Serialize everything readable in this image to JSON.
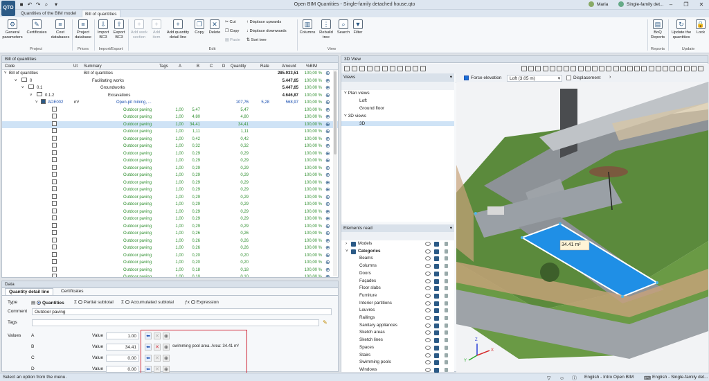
{
  "window": {
    "title": "Open BIM Quantities - Single-family detached house.qto",
    "user": "Maria",
    "project": "Single-family det...",
    "logo": "QTO"
  },
  "ribbon_tabs": [
    "Quantities of the BIM model",
    "Bill of quantities"
  ],
  "ribbon": {
    "groups": [
      "Project",
      "Prices",
      "Import/Export",
      "Edit",
      "View",
      "Reports",
      "Update"
    ],
    "general_parameters": "General parameters",
    "certificates": "Certificates",
    "cost_databases": "Cost databases",
    "project_database": "Project database",
    "import_bc3": "Import BC3",
    "export_bc3": "Export BC3",
    "add_work_section": "Add work section",
    "add_item": "Add item",
    "add_quantity_detail_line": "Add quantity detail line",
    "copy": "Copy",
    "delete": "Delete",
    "cut": "Cut",
    "copy_small": "Copy",
    "paste": "Paste",
    "displace_upwards": "Displace upwards",
    "displace_downwards": "Displace downwards",
    "sort_tree": "Sort tree",
    "columns": "Columns",
    "rebuild_tree": "Rebuild tree",
    "search": "Search",
    "filter": "Filter",
    "boq_reports": "BoQ Reports",
    "update_quantities": "Update the quantities",
    "lock": "Lock"
  },
  "boq": {
    "panel_title": "Bill of quantities",
    "columns": [
      "Code",
      "Ut",
      "Summary",
      "Tags",
      "A",
      "B",
      "C",
      "D",
      "Quantity",
      "Rate",
      "Amount",
      "%BIM"
    ],
    "rows": [
      {
        "code": "Bill of quantities",
        "ut": "",
        "summary": "Bill of quantities",
        "a": "",
        "b": "",
        "quantity": "",
        "rate": "",
        "amount": "285.933,51",
        "bim": "100,00 %",
        "kind": "root"
      },
      {
        "code": "0",
        "ut": "",
        "summary": "Facilitating works",
        "a": "",
        "b": "",
        "quantity": "",
        "rate": "",
        "amount": "5.447,65",
        "bim": "100,00 %",
        "kind": "chapter"
      },
      {
        "code": "0.1",
        "ut": "",
        "summary": "Groundworks",
        "a": "",
        "b": "",
        "quantity": "",
        "rate": "",
        "amount": "5.447,65",
        "bim": "100,00 %",
        "kind": "chapter"
      },
      {
        "code": "0.1.2",
        "ut": "",
        "summary": "Excavations",
        "a": "",
        "b": "",
        "quantity": "",
        "rate": "",
        "amount": "4.646,87",
        "bim": "100,00 %",
        "kind": "chapter"
      },
      {
        "code": "ADE002",
        "ut": "m³",
        "summary": "Open-pit mining, ...",
        "a": "",
        "b": "",
        "quantity": "107,76",
        "rate": "5,28",
        "amount": "568,97",
        "bim": "100,00 %",
        "kind": "item"
      },
      {
        "code": "",
        "ut": "",
        "summary": "Outdoor paving",
        "a": "1,00",
        "b": "5,47",
        "quantity": "5,47",
        "rate": "",
        "amount": "",
        "bim": "100,00 %",
        "kind": "line"
      },
      {
        "code": "",
        "ut": "",
        "summary": "Outdoor paving",
        "a": "1,00",
        "b": "4,80",
        "quantity": "4,80",
        "rate": "",
        "amount": "",
        "bim": "100,00 %",
        "kind": "line"
      },
      {
        "code": "",
        "ut": "",
        "summary": "Outdoor paving",
        "a": "1,00",
        "b": "34,41",
        "quantity": "34,41",
        "rate": "",
        "amount": "",
        "bim": "100,00 %",
        "kind": "line",
        "selected": true
      },
      {
        "code": "",
        "ut": "",
        "summary": "Outdoor paving",
        "a": "1,00",
        "b": "1,11",
        "quantity": "1,11",
        "rate": "",
        "amount": "",
        "bim": "100,00 %",
        "kind": "line"
      },
      {
        "code": "",
        "ut": "",
        "summary": "Outdoor paving",
        "a": "1,00",
        "b": "0,42",
        "quantity": "0,42",
        "rate": "",
        "amount": "",
        "bim": "100,00 %",
        "kind": "line"
      },
      {
        "code": "",
        "ut": "",
        "summary": "Outdoor paving",
        "a": "1,00",
        "b": "0,32",
        "quantity": "0,32",
        "rate": "",
        "amount": "",
        "bim": "100,00 %",
        "kind": "line"
      },
      {
        "code": "",
        "ut": "",
        "summary": "Outdoor paving",
        "a": "1,00",
        "b": "0,29",
        "quantity": "0,29",
        "rate": "",
        "amount": "",
        "bim": "100,00 %",
        "kind": "line"
      },
      {
        "code": "",
        "ut": "",
        "summary": "Outdoor paving",
        "a": "1,00",
        "b": "0,29",
        "quantity": "0,29",
        "rate": "",
        "amount": "",
        "bim": "100,00 %",
        "kind": "line"
      },
      {
        "code": "",
        "ut": "",
        "summary": "Outdoor paving",
        "a": "1,00",
        "b": "0,29",
        "quantity": "0,29",
        "rate": "",
        "amount": "",
        "bim": "100,00 %",
        "kind": "line"
      },
      {
        "code": "",
        "ut": "",
        "summary": "Outdoor paving",
        "a": "1,00",
        "b": "0,29",
        "quantity": "0,29",
        "rate": "",
        "amount": "",
        "bim": "100,00 %",
        "kind": "line"
      },
      {
        "code": "",
        "ut": "",
        "summary": "Outdoor paving",
        "a": "1,00",
        "b": "0,29",
        "quantity": "0,29",
        "rate": "",
        "amount": "",
        "bim": "100,00 %",
        "kind": "line"
      },
      {
        "code": "",
        "ut": "",
        "summary": "Outdoor paving",
        "a": "1,00",
        "b": "0,29",
        "quantity": "0,29",
        "rate": "",
        "amount": "",
        "bim": "100,00 %",
        "kind": "line"
      },
      {
        "code": "",
        "ut": "",
        "summary": "Outdoor paving",
        "a": "1,00",
        "b": "0,29",
        "quantity": "0,29",
        "rate": "",
        "amount": "",
        "bim": "100,00 %",
        "kind": "line"
      },
      {
        "code": "",
        "ut": "",
        "summary": "Outdoor paving",
        "a": "1,00",
        "b": "0,29",
        "quantity": "0,29",
        "rate": "",
        "amount": "",
        "bim": "100,00 %",
        "kind": "line"
      },
      {
        "code": "",
        "ut": "",
        "summary": "Outdoor paving",
        "a": "1,00",
        "b": "0,29",
        "quantity": "0,29",
        "rate": "",
        "amount": "",
        "bim": "100,00 %",
        "kind": "line"
      },
      {
        "code": "",
        "ut": "",
        "summary": "Outdoor paving",
        "a": "1,00",
        "b": "0,29",
        "quantity": "0,29",
        "rate": "",
        "amount": "",
        "bim": "100,00 %",
        "kind": "line"
      },
      {
        "code": "",
        "ut": "",
        "summary": "Outdoor paving",
        "a": "1,00",
        "b": "0,29",
        "quantity": "0,29",
        "rate": "",
        "amount": "",
        "bim": "100,00 %",
        "kind": "line"
      },
      {
        "code": "",
        "ut": "",
        "summary": "Outdoor paving",
        "a": "1,00",
        "b": "0,26",
        "quantity": "0,26",
        "rate": "",
        "amount": "",
        "bim": "100,00 %",
        "kind": "line"
      },
      {
        "code": "",
        "ut": "",
        "summary": "Outdoor paving",
        "a": "1,00",
        "b": "0,26",
        "quantity": "0,26",
        "rate": "",
        "amount": "",
        "bim": "100,00 %",
        "kind": "line"
      },
      {
        "code": "",
        "ut": "",
        "summary": "Outdoor paving",
        "a": "1,00",
        "b": "0,26",
        "quantity": "0,26",
        "rate": "",
        "amount": "",
        "bim": "100,00 %",
        "kind": "line"
      },
      {
        "code": "",
        "ut": "",
        "summary": "Outdoor paving",
        "a": "1,00",
        "b": "0,20",
        "quantity": "0,20",
        "rate": "",
        "amount": "",
        "bim": "100,00 %",
        "kind": "line"
      },
      {
        "code": "",
        "ut": "",
        "summary": "Outdoor paving",
        "a": "1,00",
        "b": "0,20",
        "quantity": "0,20",
        "rate": "",
        "amount": "",
        "bim": "100,00 %",
        "kind": "line"
      },
      {
        "code": "",
        "ut": "",
        "summary": "Outdoor paving",
        "a": "1,00",
        "b": "0,18",
        "quantity": "0,18",
        "rate": "",
        "amount": "",
        "bim": "100,00 %",
        "kind": "line"
      },
      {
        "code": "",
        "ut": "",
        "summary": "Outdoor paving",
        "a": "1,00",
        "b": "0,10",
        "quantity": "0,10",
        "rate": "",
        "amount": "",
        "bim": "100,00 %",
        "kind": "line"
      },
      {
        "code": "",
        "ut": "",
        "summary": "Outdoor paving",
        "a": "1,00",
        "b": "0,09",
        "quantity": "0,09",
        "rate": "",
        "amount": "",
        "bim": "100,00 %",
        "kind": "line"
      }
    ]
  },
  "data_panel": {
    "title": "Data",
    "tabs": [
      "Quantity detail line",
      "Certificates"
    ],
    "type_label": "Type",
    "type_options": [
      "Quantities",
      "Partial subtotal",
      "Accumulated subtotal",
      "Expression"
    ],
    "comment_label": "Comment",
    "comment_value": "Outdoor paving",
    "tags_label": "Tags",
    "values_label": "Values",
    "value_word": "Value",
    "values": [
      {
        "name": "A",
        "value": "1.00",
        "note": ""
      },
      {
        "name": "B",
        "value": "34.41",
        "note": "swimming pool area. Area: 34.41 m²"
      },
      {
        "name": "C",
        "value": "0.00",
        "note": ""
      },
      {
        "name": "D",
        "value": "0.00",
        "note": ""
      }
    ]
  },
  "view3d": {
    "title": "3D View",
    "force_elevation": "Force elevation",
    "level": "Loft (3.05 m)",
    "displacement": "Displacement",
    "views_title": "Views",
    "plan_views": "Plan views",
    "plan_items": [
      "Loft",
      "Ground floor"
    ],
    "views_3d": "3D views",
    "views_3d_items": [
      "3D"
    ],
    "elements_title": "Elements read",
    "models": "Models",
    "categories": "Categories",
    "category_items": [
      "Beams",
      "Columns",
      "Doors",
      "Façades",
      "Floor slabs",
      "Furniture",
      "Interior partitions",
      "Louvres",
      "Railings",
      "Sanitary appliances",
      "Sketch areas",
      "Sketch lines",
      "Spaces",
      "Stairs",
      "Swimming pools",
      "Windows"
    ],
    "area_label": "34.41 m²",
    "axes": {
      "x": "X",
      "y": "Y",
      "z": "Z"
    }
  },
  "status": {
    "message": "Select an option from the menu.",
    "lang1": "English - Intro Open BIM",
    "lang2": "English - Single-family det..."
  },
  "colors": {
    "accent": "#2b5a86",
    "green_text": "#2f8f2f",
    "selection": "#cfe3f6",
    "highlight_box": "#d12b3b",
    "pool": "#1f8fe6",
    "grass": "#5a8a3a"
  }
}
